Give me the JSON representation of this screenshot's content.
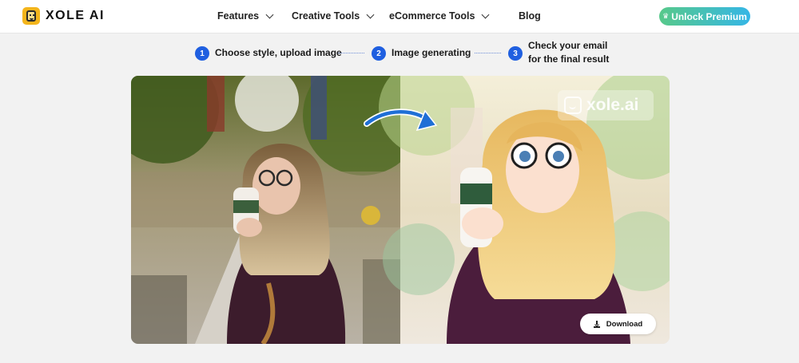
{
  "brand": {
    "name": "XOLE AI",
    "accent": "#f4b51c"
  },
  "nav": {
    "items": [
      {
        "label": "Features",
        "has_dropdown": true
      },
      {
        "label": "Creative Tools",
        "has_dropdown": true
      },
      {
        "label": "eCommerce Tools",
        "has_dropdown": true
      },
      {
        "label": "Blog",
        "has_dropdown": false
      }
    ],
    "cta": {
      "label": "Unlock Premium",
      "icon": "crown-icon"
    }
  },
  "steps": [
    {
      "number": "1",
      "line1": "Choose style, upload image",
      "line2": ""
    },
    {
      "number": "2",
      "line1": "Image generating",
      "line2": ""
    },
    {
      "number": "3",
      "line1": "Check your email",
      "line2": "for the final result"
    }
  ],
  "result": {
    "before_image": "photo-original",
    "after_image": "photo-anime-style",
    "transform_icon": "curved-arrow-icon",
    "watermark": "xole.ai",
    "download_label": "Download",
    "download_icon": "download-icon"
  },
  "colors": {
    "step_badge": "#1f5fe0",
    "premium_gradient_start": "#57c98a",
    "premium_gradient_end": "#35b6e6"
  }
}
